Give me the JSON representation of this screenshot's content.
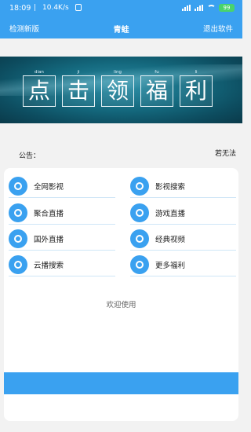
{
  "status": {
    "time": "18:09",
    "speed": "10.4K/s",
    "battery": "99"
  },
  "nav": {
    "left": "检测新版",
    "title": "青蛙",
    "right": "退出软件"
  },
  "banner": {
    "chars": [
      {
        "pinyin": "dian",
        "char": "点"
      },
      {
        "pinyin": "ji",
        "char": "击"
      },
      {
        "pinyin": "ling",
        "char": "领"
      },
      {
        "pinyin": "fu",
        "char": "福"
      },
      {
        "pinyin": "li",
        "char": "利"
      }
    ]
  },
  "notice": {
    "label": "公告：",
    "text": "若无法"
  },
  "menu": [
    {
      "label": "全网影视"
    },
    {
      "label": "影视搜索"
    },
    {
      "label": "聚合直播"
    },
    {
      "label": "游戏直播"
    },
    {
      "label": "国外直播"
    },
    {
      "label": "经典视频"
    },
    {
      "label": "云播搜索"
    },
    {
      "label": "更多福利"
    }
  ],
  "welcome": "欢迎使用",
  "colors": {
    "primary": "#3aa1f0",
    "background": "#f2f2f2"
  }
}
